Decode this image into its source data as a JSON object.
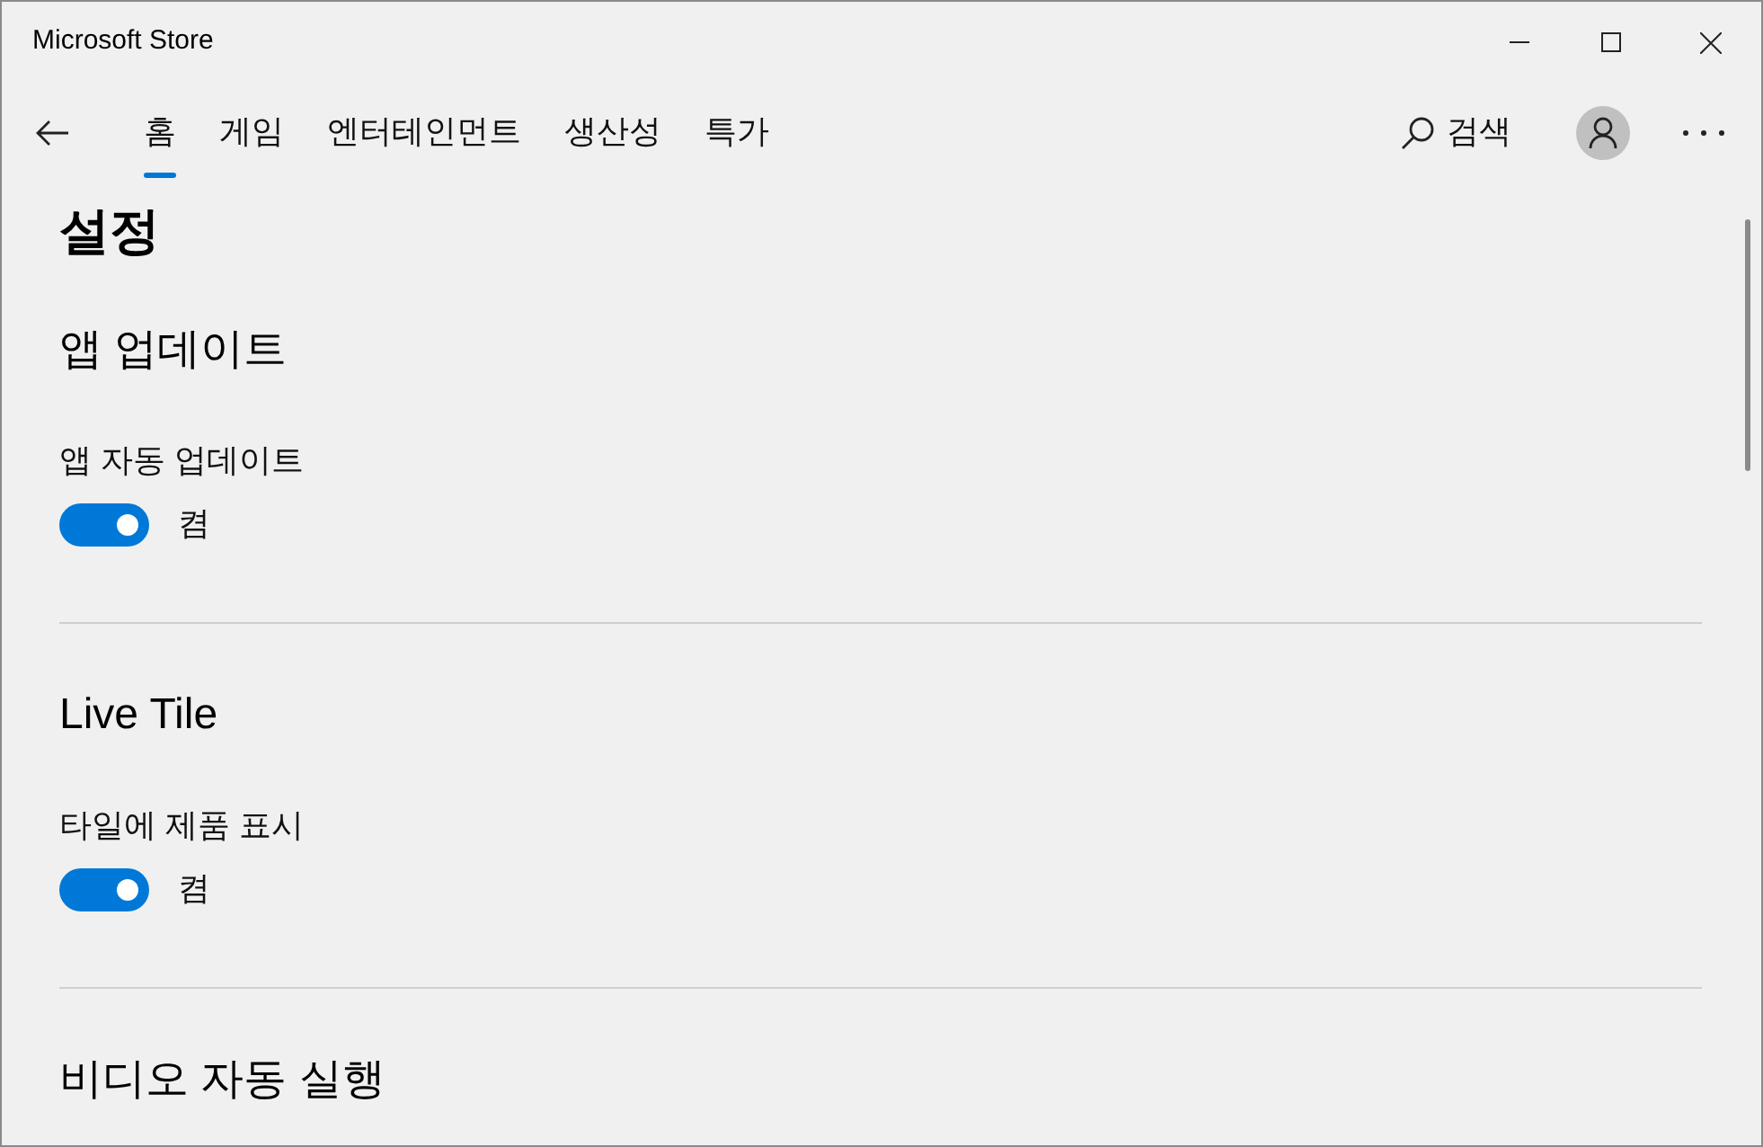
{
  "window": {
    "title": "Microsoft Store"
  },
  "nav": {
    "tabs": [
      {
        "label": "홈",
        "selected": true
      },
      {
        "label": "게임",
        "selected": false
      },
      {
        "label": "엔터테인먼트",
        "selected": false
      },
      {
        "label": "생산성",
        "selected": false
      },
      {
        "label": "특가",
        "selected": false
      }
    ],
    "search": "검색"
  },
  "page": {
    "title": "설정",
    "sections": [
      {
        "heading": "앱 업데이트",
        "settings": [
          {
            "label": "앱 자동 업데이트",
            "on": true,
            "state_text": "켬"
          }
        ]
      },
      {
        "heading": "Live Tile",
        "settings": [
          {
            "label": "타일에 제품 표시",
            "on": true,
            "state_text": "켬"
          }
        ]
      },
      {
        "heading": "비디오 자동 실행"
      }
    ]
  }
}
